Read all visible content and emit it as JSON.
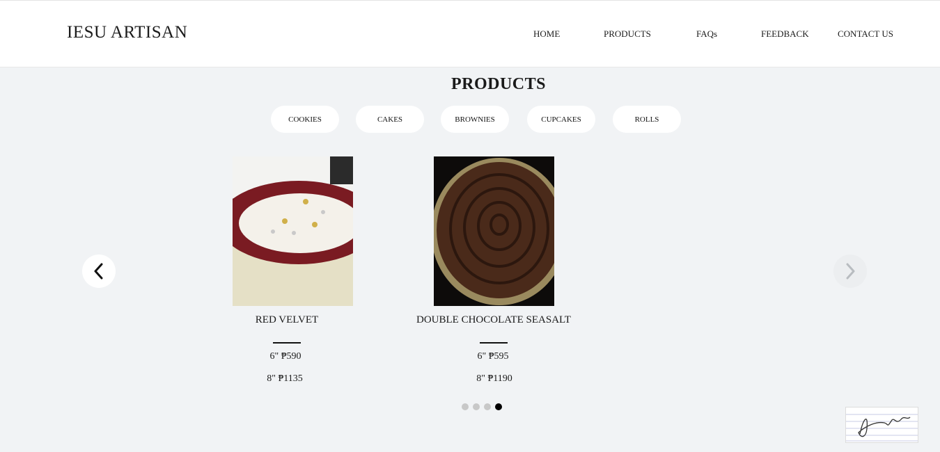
{
  "header": {
    "brand": "IESU ARTISAN",
    "nav": [
      "HOME",
      "PRODUCTS",
      "FAQs",
      "FEEDBACK",
      "CONTACT US"
    ]
  },
  "section": {
    "title": "PRODUCTS"
  },
  "categories": [
    "COOKIES",
    "CAKES",
    "BROWNIES",
    "CUPCAKES",
    "ROLLS"
  ],
  "carousel": {
    "prev_icon": "chevron-left-icon",
    "next_icon": "chevron-right-icon",
    "items": [
      {
        "name": "RED VELVET",
        "prices": [
          "6\" ₱590",
          "8\" ₱1135"
        ]
      },
      {
        "name": "DOUBLE CHOCOLATE SEASALT",
        "prices": [
          "6\" ₱595",
          "8\" ₱1190"
        ]
      }
    ],
    "page_count": 4,
    "active_page": 4
  },
  "colors": {
    "background": "#f1f3f5",
    "header": "#ffffff",
    "text": "#111111",
    "active_dot": "#000000",
    "inactive_dot": "#c8c8c8"
  }
}
